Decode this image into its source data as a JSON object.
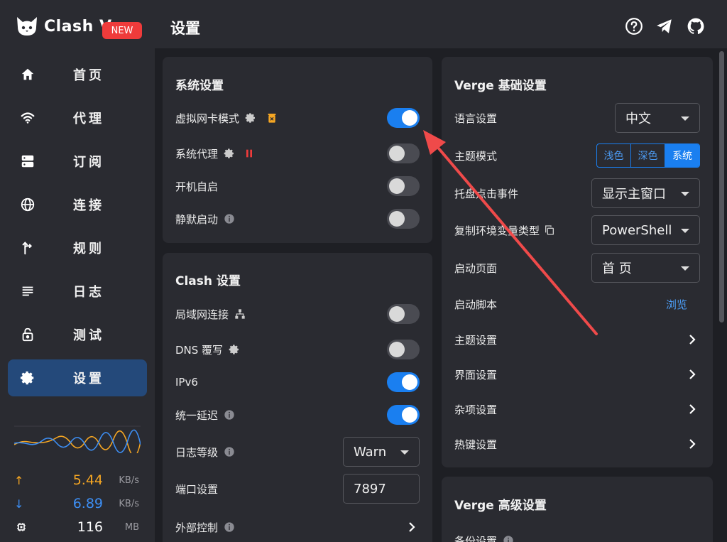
{
  "app": {
    "name": "Clash V",
    "badge": "NEW"
  },
  "sidebar": {
    "items": [
      {
        "label": "首页",
        "icon": "home-icon"
      },
      {
        "label": "代理",
        "icon": "wifi-icon"
      },
      {
        "label": "订阅",
        "icon": "server-icon"
      },
      {
        "label": "连接",
        "icon": "globe-icon"
      },
      {
        "label": "规则",
        "icon": "route-icon"
      },
      {
        "label": "日志",
        "icon": "list-icon"
      },
      {
        "label": "测试",
        "icon": "lock-icon"
      },
      {
        "label": "设置",
        "icon": "gear-icon",
        "active": true
      }
    ],
    "traffic": {
      "upload": {
        "value": "5.44",
        "unit": "KB/s",
        "color": "#f5a623"
      },
      "download": {
        "value": "6.89",
        "unit": "KB/s",
        "color": "#3d8ff5"
      },
      "memory": {
        "value": "116",
        "unit": "MB"
      }
    }
  },
  "header": {
    "title": "设置"
  },
  "system": {
    "title": "系统设置",
    "rows": [
      {
        "label": "虚拟网卡模式",
        "on": true
      },
      {
        "label": "系统代理",
        "on": false
      },
      {
        "label": "开机自启",
        "on": false
      },
      {
        "label": "静默启动",
        "on": false
      }
    ]
  },
  "clash": {
    "title": "Clash 设置",
    "rows": [
      {
        "label": "局域网连接",
        "on": false
      },
      {
        "label": "DNS 覆写",
        "on": false
      },
      {
        "label": "IPv6",
        "on": true
      },
      {
        "label": "统一延迟",
        "on": true
      }
    ],
    "log_level": {
      "label": "日志等级",
      "value": "Warn"
    },
    "port": {
      "label": "端口设置",
      "value": "7897"
    },
    "external": {
      "label": "外部控制"
    }
  },
  "verge_basic": {
    "title": "Verge 基础设置",
    "language": {
      "label": "语言设置",
      "value": "中文"
    },
    "theme_mode": {
      "label": "主题模式",
      "options": [
        "浅色",
        "深色",
        "系统"
      ],
      "selected": 2
    },
    "tray_click": {
      "label": "托盘点击事件",
      "value": "显示主窗口"
    },
    "copy_env": {
      "label": "复制环境变量类型",
      "value": "PowerShell"
    },
    "start_page": {
      "label": "启动页面",
      "value": "首 页"
    },
    "start_script": {
      "label": "启动脚本",
      "action": "浏览"
    },
    "links": [
      "主题设置",
      "界面设置",
      "杂项设置",
      "热键设置"
    ]
  },
  "verge_advanced": {
    "title": "Verge 高级设置",
    "backup": {
      "label": "备份设置"
    }
  },
  "colors": {
    "accent": "#1a7ff0",
    "warning": "#f5a623",
    "danger": "#ef3b3b",
    "annotation": "#ef4a4a"
  }
}
